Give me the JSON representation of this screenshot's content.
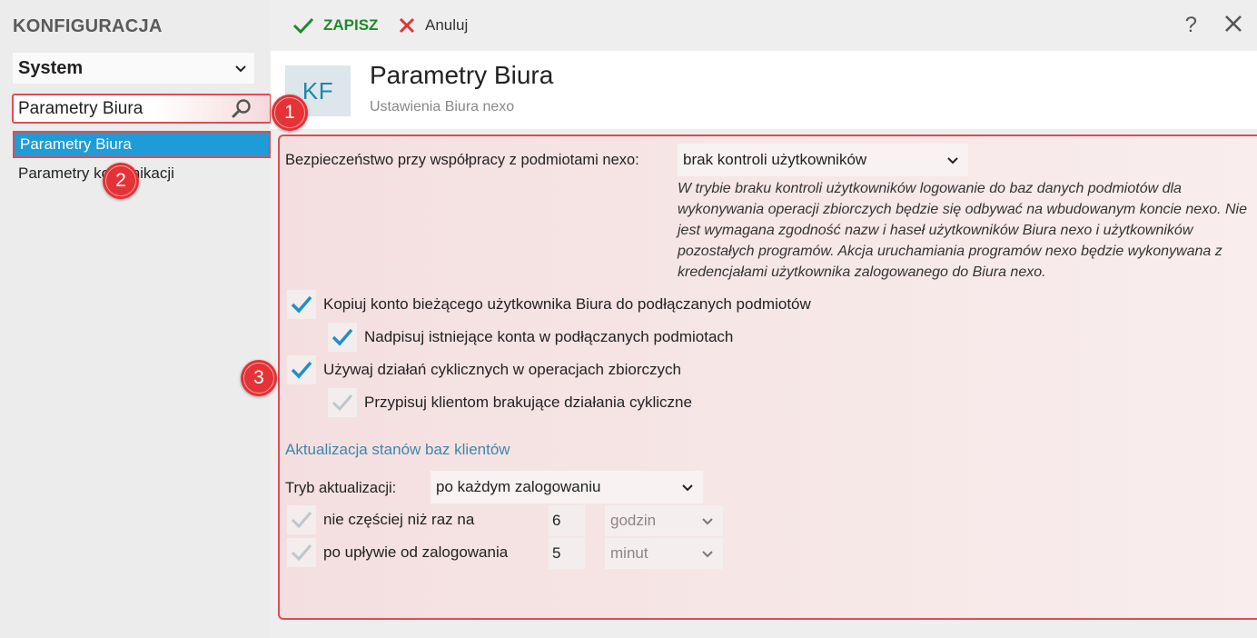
{
  "app": {
    "title": "KONFIGURACJA"
  },
  "toolbar": {
    "save_label": "ZAPISZ",
    "cancel_label": "Anuluj",
    "help_label": "?"
  },
  "sidebar": {
    "module_select": "System",
    "search": {
      "value": "Parametry Biura"
    },
    "items": [
      {
        "label": "Parametry Biura",
        "active": true
      },
      {
        "label": "Parametry komunikacji",
        "active": false
      }
    ]
  },
  "badges": [
    "1",
    "2",
    "3"
  ],
  "header": {
    "logo": "KF",
    "title": "Parametry Biura",
    "subtitle": "Ustawienia Biura nexo"
  },
  "content": {
    "security": {
      "label": "Bezpieczeństwo przy współpracy z podmiotami nexo:",
      "value": "brak kontroli użytkowników",
      "description": "W trybie braku kontroli użytkowników logowanie do baz danych podmiotów dla wykonywania operacji zbiorczych będzie się odbywać na wbudowanym koncie nexo. Nie jest wymagana zgodność nazw i haseł użytkowników Biura nexo i użytkowników pozostałych programów. Akcja uruchamiania programów nexo będzie wykonywana z kredencjałami użytkownika zalogowanego do Biura nexo."
    },
    "checkboxes": [
      {
        "label": "Kopiuj konto bieżącego użytkownika Biura do podłączanych podmiotów",
        "checked": true,
        "enabled": true
      },
      {
        "label": "Nadpisuj istniejące konta w podłączanych podmiotach",
        "checked": true,
        "enabled": true
      },
      {
        "label": "Używaj działań cyklicznych w operacjach zbiorczych",
        "checked": true,
        "enabled": true
      },
      {
        "label": "Przypisuj klientom brakujące działania cykliczne",
        "checked": true,
        "enabled": false
      }
    ],
    "update_section": {
      "title": "Aktualizacja stanów baz klientów",
      "mode_label": "Tryb aktualizacji:",
      "mode_value": "po każdym zalogowaniu",
      "rows": [
        {
          "label": "nie częściej niż raz na",
          "value": "6",
          "unit": "godzin"
        },
        {
          "label": "po upływie od zalogowania",
          "value": "5",
          "unit": "minut"
        }
      ]
    }
  },
  "colors": {
    "accent": "#1e9cd7",
    "highlight": "#e24b52",
    "save": "#1f8a2a",
    "check": "#1e90c8",
    "section": "#3d87a8"
  }
}
